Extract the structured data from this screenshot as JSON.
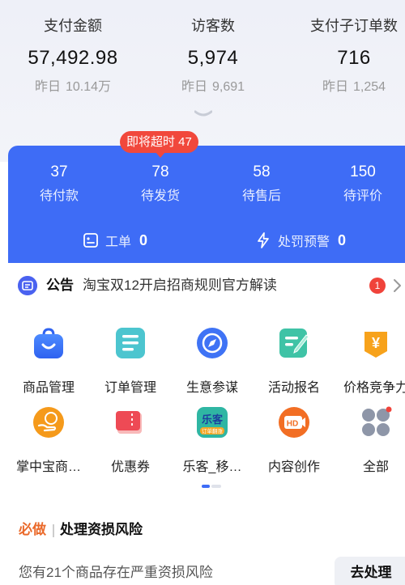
{
  "stats": [
    {
      "label": "支付金额",
      "value": "57,492.98",
      "yesterday_label": "昨日",
      "yesterday_value": "10.14万"
    },
    {
      "label": "访客数",
      "value": "5,974",
      "yesterday_label": "昨日",
      "yesterday_value": "9,691"
    },
    {
      "label": "支付子订单数",
      "value": "716",
      "yesterday_label": "昨日",
      "yesterday_value": "1,254"
    }
  ],
  "orders": {
    "badge": "即将超时 47",
    "items": [
      {
        "count": "37",
        "label": "待付款"
      },
      {
        "count": "78",
        "label": "待发货"
      },
      {
        "count": "58",
        "label": "待售后"
      },
      {
        "count": "150",
        "label": "待评价"
      }
    ],
    "tools": [
      {
        "label": "工单",
        "count": "0",
        "icon": "ticket-icon"
      },
      {
        "label": "处罚预警",
        "count": "0",
        "icon": "lightning-icon"
      }
    ]
  },
  "notice": {
    "title": "公告",
    "text": "淘宝双12开启招商规则官方解读",
    "count": "1"
  },
  "grid": [
    {
      "label": "商品管理",
      "icon": "shopping-bag-icon"
    },
    {
      "label": "订单管理",
      "icon": "order-list-icon"
    },
    {
      "label": "生意参谋",
      "icon": "compass-icon"
    },
    {
      "label": "活动报名",
      "icon": "signup-icon"
    },
    {
      "label": "价格竞争力",
      "icon": "price-icon"
    },
    {
      "label": "掌中宝商…",
      "icon": "hand-coin-icon"
    },
    {
      "label": "优惠券",
      "icon": "coupon-icon"
    },
    {
      "label": "乐客_移…",
      "icon": "leke-icon"
    },
    {
      "label": "内容创作",
      "icon": "hd-video-icon"
    },
    {
      "label": "全部",
      "icon": "all-apps-icon"
    }
  ],
  "leke_icon_text": {
    "top": "乐客",
    "bottom": "订单翻涨"
  },
  "hd_icon_text": "HD",
  "price_icon_text": "¥",
  "must_do": {
    "tag": "必做",
    "title": "处理资损风险",
    "description": "您有21个商品存在严重资损风险",
    "button": "去处理"
  },
  "colors": {
    "accent_blue": "#3e6cf6",
    "badge_red": "#f1483c",
    "must_orange": "#ea6a2b"
  }
}
